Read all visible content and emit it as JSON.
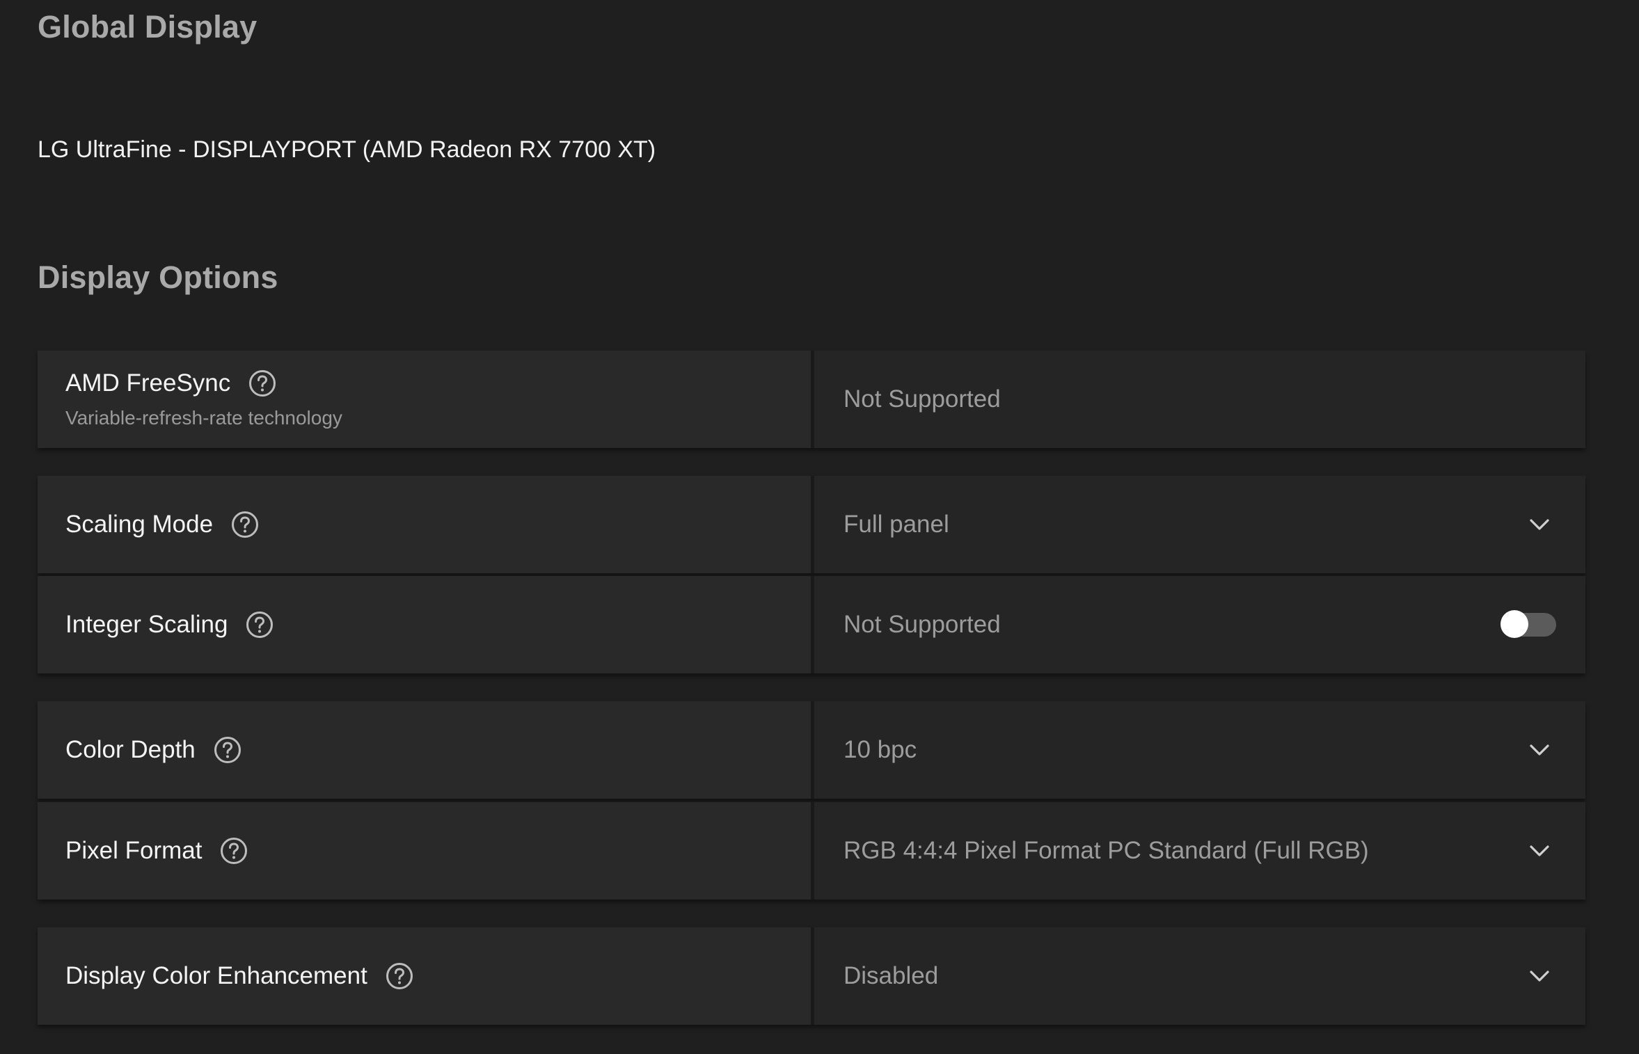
{
  "header": {
    "global_title": "Global Display",
    "device_name": "LG UltraFine - DISPLAYPORT (AMD Radeon RX 7700 XT)",
    "options_title": "Display Options"
  },
  "settings": {
    "freesync": {
      "label": "AMD FreeSync",
      "sublabel": "Variable-refresh-rate technology",
      "value": "Not Supported"
    },
    "scaling_mode": {
      "label": "Scaling Mode",
      "value": "Full panel"
    },
    "integer_scaling": {
      "label": "Integer Scaling",
      "value": "Not Supported",
      "toggle_on": false
    },
    "color_depth": {
      "label": "Color Depth",
      "value": "10 bpc"
    },
    "pixel_format": {
      "label": "Pixel Format",
      "value": "RGB 4:4:4 Pixel Format PC Standard (Full RGB)"
    },
    "color_enhancement": {
      "label": "Display Color Enhancement",
      "value": "Disabled"
    }
  },
  "icons": {
    "help": "help-circle-icon",
    "dropdown": "chevron-down-icon"
  },
  "colors": {
    "background": "#1f1f1f",
    "panel_left": "#292929",
    "panel_right": "#252525",
    "toggle_track": "#5b5b5b"
  }
}
